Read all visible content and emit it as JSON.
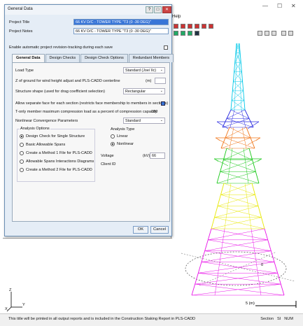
{
  "app": {
    "menu_help": "Help",
    "status_text": "This title will be printed in all output reports and is included in the Construction Staking Report in PLS-CADD",
    "status_right": [
      "Section",
      "SI",
      "NUM"
    ],
    "scale_label": "5 (m)",
    "axis_x": "X",
    "axis_y": "Y",
    "axis_z": "Z",
    "angle_label_left": "180",
    "angle_label_right": "0",
    "tower_colors": [
      "#00c8e8",
      "#2a2ae0",
      "#f07010",
      "#18c818",
      "#e8e800",
      "#e810e8"
    ]
  },
  "dialog": {
    "title": "General Data",
    "help_button": "?",
    "maximize_button": "□",
    "close_button": "✕",
    "project_title_label": "Project Title",
    "project_title_value": "66 KV D/C - TOWER TYPE \"T3 (0 -30 DEG)\"",
    "project_notes_label": "Project Notes",
    "project_notes_value": "66 KV D/C - TOWER TYPE \"T3 (0 -30 DEG)\"",
    "revision_tracking_label": "Enable automatic project revision-tracking during each save",
    "revision_tracking_checked": false,
    "tabs": [
      {
        "label": "General Data",
        "active": true
      },
      {
        "label": "Design Checks",
        "active": false
      },
      {
        "label": "Design Check Options",
        "active": false
      },
      {
        "label": "Redundant Members",
        "active": false
      }
    ],
    "load_type_label": "Load Type",
    "load_type_value": "Standard (Joe/ Ilc)",
    "z_ground_label": "Z of ground for wind height adjust and PLS-CADD centerline",
    "z_ground_unit": "(m)",
    "z_ground_value": "",
    "structure_shape_label": "Structure shape (used for drag coefficient selection)",
    "structure_shape_value": "Rectangular",
    "separate_face_label": "Allow separate face for each section (restricts face membership to members in sections)",
    "separate_face_checked": true,
    "tension_only_label": "T-only member maximum compression load as a percent of compression capacity",
    "tension_only_value": "100",
    "nonlinear_label": "Nonlinear Convergence Parameters",
    "nonlinear_value": "Standard",
    "analysis_options_title": "Analysis Options",
    "analysis_options": [
      {
        "label": "Design Check for Single Structure",
        "selected": true
      },
      {
        "label": "Basic Allowable Spans",
        "selected": false
      },
      {
        "label": "Create a Method 1 File for PLS-CADD",
        "selected": false
      },
      {
        "label": "Allowable Spans Interactions Diagrams",
        "selected": false
      },
      {
        "label": "Create a Method 2 File for PLS-CADD",
        "selected": false
      }
    ],
    "analysis_type_title": "Analysis Type",
    "analysis_types": [
      {
        "label": "Linear",
        "selected": false
      },
      {
        "label": "Nonlinear",
        "selected": true
      }
    ],
    "voltage_label": "Voltage",
    "voltage_unit": "(kV)",
    "voltage_value": "66",
    "client_id_label": "Client ID",
    "ok_button": "OK",
    "cancel_button": "Cancel"
  }
}
